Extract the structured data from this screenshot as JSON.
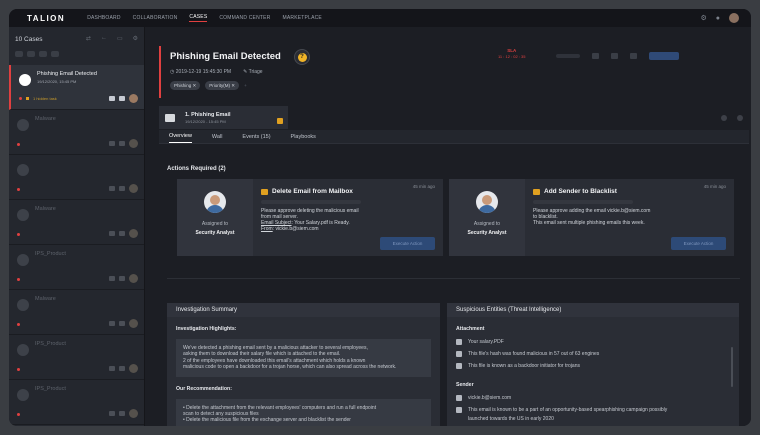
{
  "nav": {
    "logo": "TALION",
    "items": [
      "DASHBOARD",
      "COLLABORATION",
      "CASES",
      "COMMAND CENTER",
      "MARKETPLACE"
    ],
    "active": "CASES"
  },
  "sidebar": {
    "title": "10 Cases",
    "cases": [
      {
        "title": "Phishing Email Detected",
        "date": "19/12/2020, 15:45 PM",
        "meta": "1 hidden task",
        "active": true
      },
      {
        "title": "Malware",
        "date": "",
        "meta": "",
        "active": false
      },
      {
        "title": "",
        "date": "",
        "meta": "",
        "active": false
      },
      {
        "title": "Malware",
        "date": "",
        "meta": "",
        "active": false
      },
      {
        "title": "IPS_Product",
        "date": "",
        "meta": "",
        "active": false
      },
      {
        "title": "Malware",
        "date": "",
        "meta": "",
        "active": false
      },
      {
        "title": "IPS_Product",
        "date": "",
        "meta": "",
        "active": false
      },
      {
        "title": "IPS_Product",
        "date": "",
        "meta": "",
        "active": false
      }
    ]
  },
  "case": {
    "title": "Phishing Email Detected",
    "badge": "?",
    "datetime": "2019-12-19 15:45:30 PM",
    "status": "Triage",
    "tags": [
      "Phishing",
      "Priority(M)"
    ],
    "sla_label": "SLA",
    "sla_time": "11 : 12 : 02 : 35"
  },
  "workflow": {
    "title": "1. Phishing Email",
    "date": "19/12/2020 - 15:45 PM"
  },
  "tabs": [
    "Overview",
    "Wall",
    "Events (15)",
    "Playbooks"
  ],
  "actions": {
    "label": "Actions Required (2)",
    "items": [
      {
        "assigned_to_label": "Assigned to",
        "role": "Security Analyst",
        "title": "Delete Email from Mailbox",
        "time": "45 min ago",
        "text1": "Please approve deleting the malicious email",
        "text2": "from mail server.",
        "subject_label": "Email Subject",
        "subject": ": Your Salary.pdf is Ready.",
        "from_label": "From",
        "from": ": vickie.b@siem.com",
        "button": "Execute Action"
      },
      {
        "assigned_to_label": "Assigned to",
        "role": "Security Analyst",
        "title": "Add Sender to Blacklist",
        "time": "45 min ago",
        "text1": "Please approve adding the email vickie.b@siem.com",
        "text2": "to blacklist.",
        "text3": "This email sent multiple phishing emails this week.",
        "button": "Execute Action"
      }
    ]
  },
  "investigation": {
    "title": "Investigation Summary",
    "highlights_label": "Investigation Highlights:",
    "highlights": [
      "We've detected a phishing email sent by a malicious attacker to several employees,",
      "asking them to download their salary file which is attached to the email.",
      "2 of the employees have downloaded this email's attachment which holds a known",
      "malicious code to open a backdoor for a trojan horse, which can also spread across the network."
    ],
    "recommendation_label": "Our Recommendation:",
    "recommendations": [
      "• Delete the attachment from the relevant employees' computers and run a full endpoint",
      "  scan to detect any suspicious files",
      "• Delete the malicious file from the exchange server and blacklist the sender"
    ]
  },
  "entities": {
    "title": "Suspicious Entities (Threat Intelligence)",
    "attachment_label": "Attachment",
    "attachment_items": [
      "Your salary.PDF",
      "This file's hash was found malicious in 57 out of 63 engines",
      "This file is known as a backdoor initiator for trojans"
    ],
    "sender_label": "Sender",
    "sender_items": [
      "vickie.b@siem.com",
      "This email is known to be a part of an opportunity-based spearphishing campaign possibly",
      "launched towards the US in early 2020"
    ]
  }
}
